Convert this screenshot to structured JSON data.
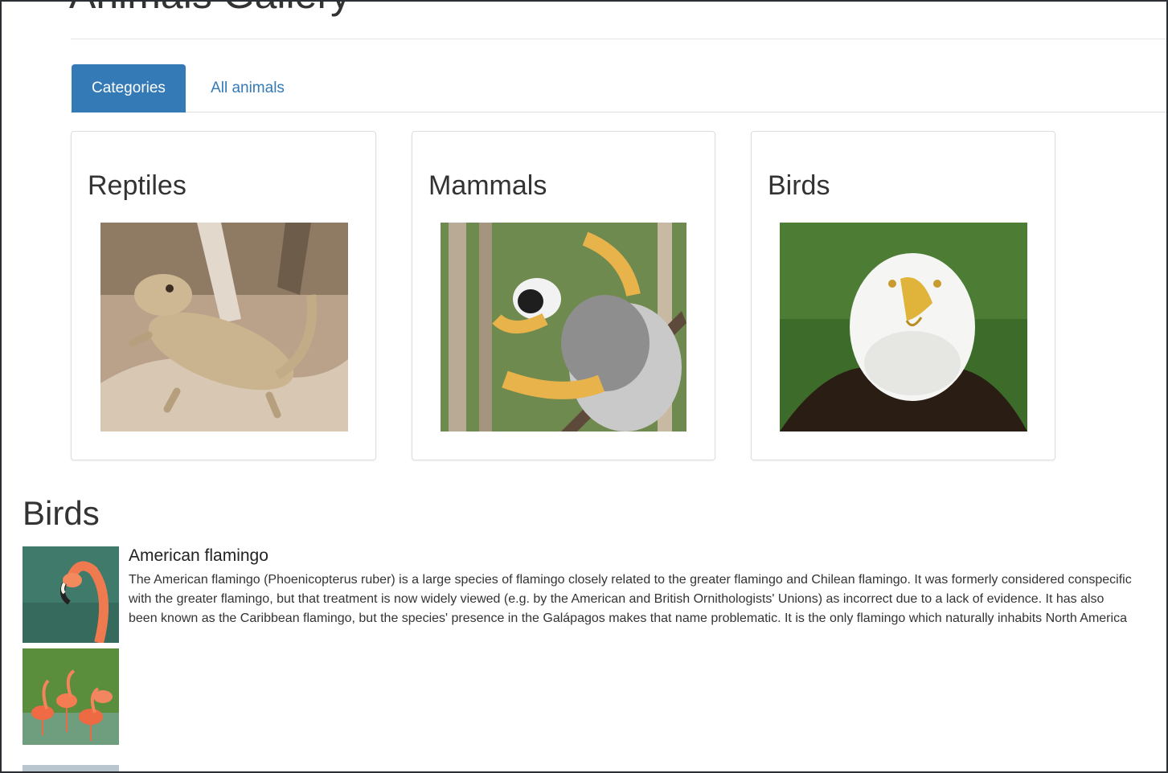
{
  "page": {
    "title": "Animals Gallery"
  },
  "tabs": [
    {
      "label": "Categories",
      "active": true
    },
    {
      "label": "All animals",
      "active": false
    }
  ],
  "categories": [
    {
      "name": "Reptiles",
      "image_icon": "bearded-dragon-photo"
    },
    {
      "name": "Mammals",
      "image_icon": "lemur-photo"
    },
    {
      "name": "Birds",
      "image_icon": "bald-eagle-photo"
    }
  ],
  "section": {
    "heading": "Birds",
    "items": [
      {
        "name": "American flamingo",
        "description": "The American flamingo (Phoenicopterus ruber) is a large species of flamingo closely related to the greater flamingo and Chilean flamingo. It was formerly considered conspecific with the greater flamingo, but that treatment is now widely viewed (e.g. by the American and British Ornithologists' Unions) as incorrect due to a lack of evidence. It has also been known as the Caribbean flamingo, but the species' presence in the Galápagos makes that name problematic. It is the only flamingo which naturally inhabits North America",
        "thumbnails": [
          "flamingo-head-photo",
          "flamingo-flock-photo"
        ]
      }
    ]
  },
  "colors": {
    "accent": "#337ab7",
    "text": "#333333",
    "border": "#dddddd"
  }
}
